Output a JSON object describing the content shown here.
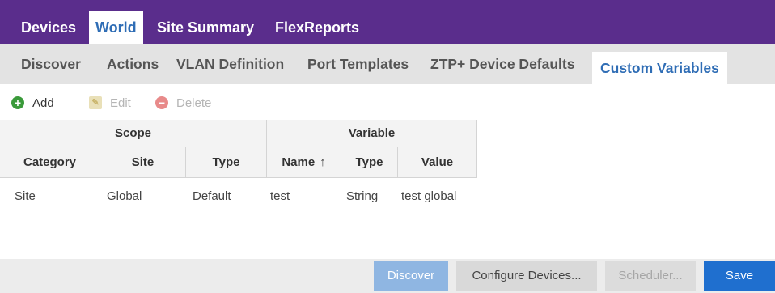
{
  "top_tabs": [
    {
      "label": "Devices",
      "active": false
    },
    {
      "label": "World",
      "active": true
    },
    {
      "label": "Site Summary",
      "active": false
    },
    {
      "label": "FlexReports",
      "active": false
    }
  ],
  "sub_tabs": [
    {
      "label": "Discover",
      "active": false
    },
    {
      "label": "Actions",
      "active": false
    },
    {
      "label": "VLAN Definition",
      "active": false
    },
    {
      "label": "Port Templates",
      "active": false
    },
    {
      "label": "ZTP+ Device Defaults",
      "active": false
    },
    {
      "label": "Custom Variables",
      "active": true
    }
  ],
  "toolbar": {
    "add_label": "Add",
    "edit_label": "Edit",
    "delete_label": "Delete",
    "add_icon": "plus-circle-icon",
    "edit_icon": "pencil-icon",
    "delete_icon": "minus-circle-icon"
  },
  "grid": {
    "groups": [
      "Scope",
      "Variable"
    ],
    "columns": [
      "Category",
      "Site",
      "Type",
      "Name",
      "Type",
      "Value"
    ],
    "sort_indicator": "↑",
    "rows": [
      [
        "Site",
        "Global",
        "Default",
        "test",
        "String",
        "test global"
      ]
    ]
  },
  "actions": {
    "discover": "Discover",
    "configure": "Configure Devices...",
    "scheduler": "Scheduler...",
    "save": "Save"
  },
  "colors": {
    "top_bar": "#5a2d8c",
    "active_tab_text": "#2f6db5",
    "save_button": "#1f6fcf",
    "discover_button_disabled": "#8fb6e2"
  }
}
